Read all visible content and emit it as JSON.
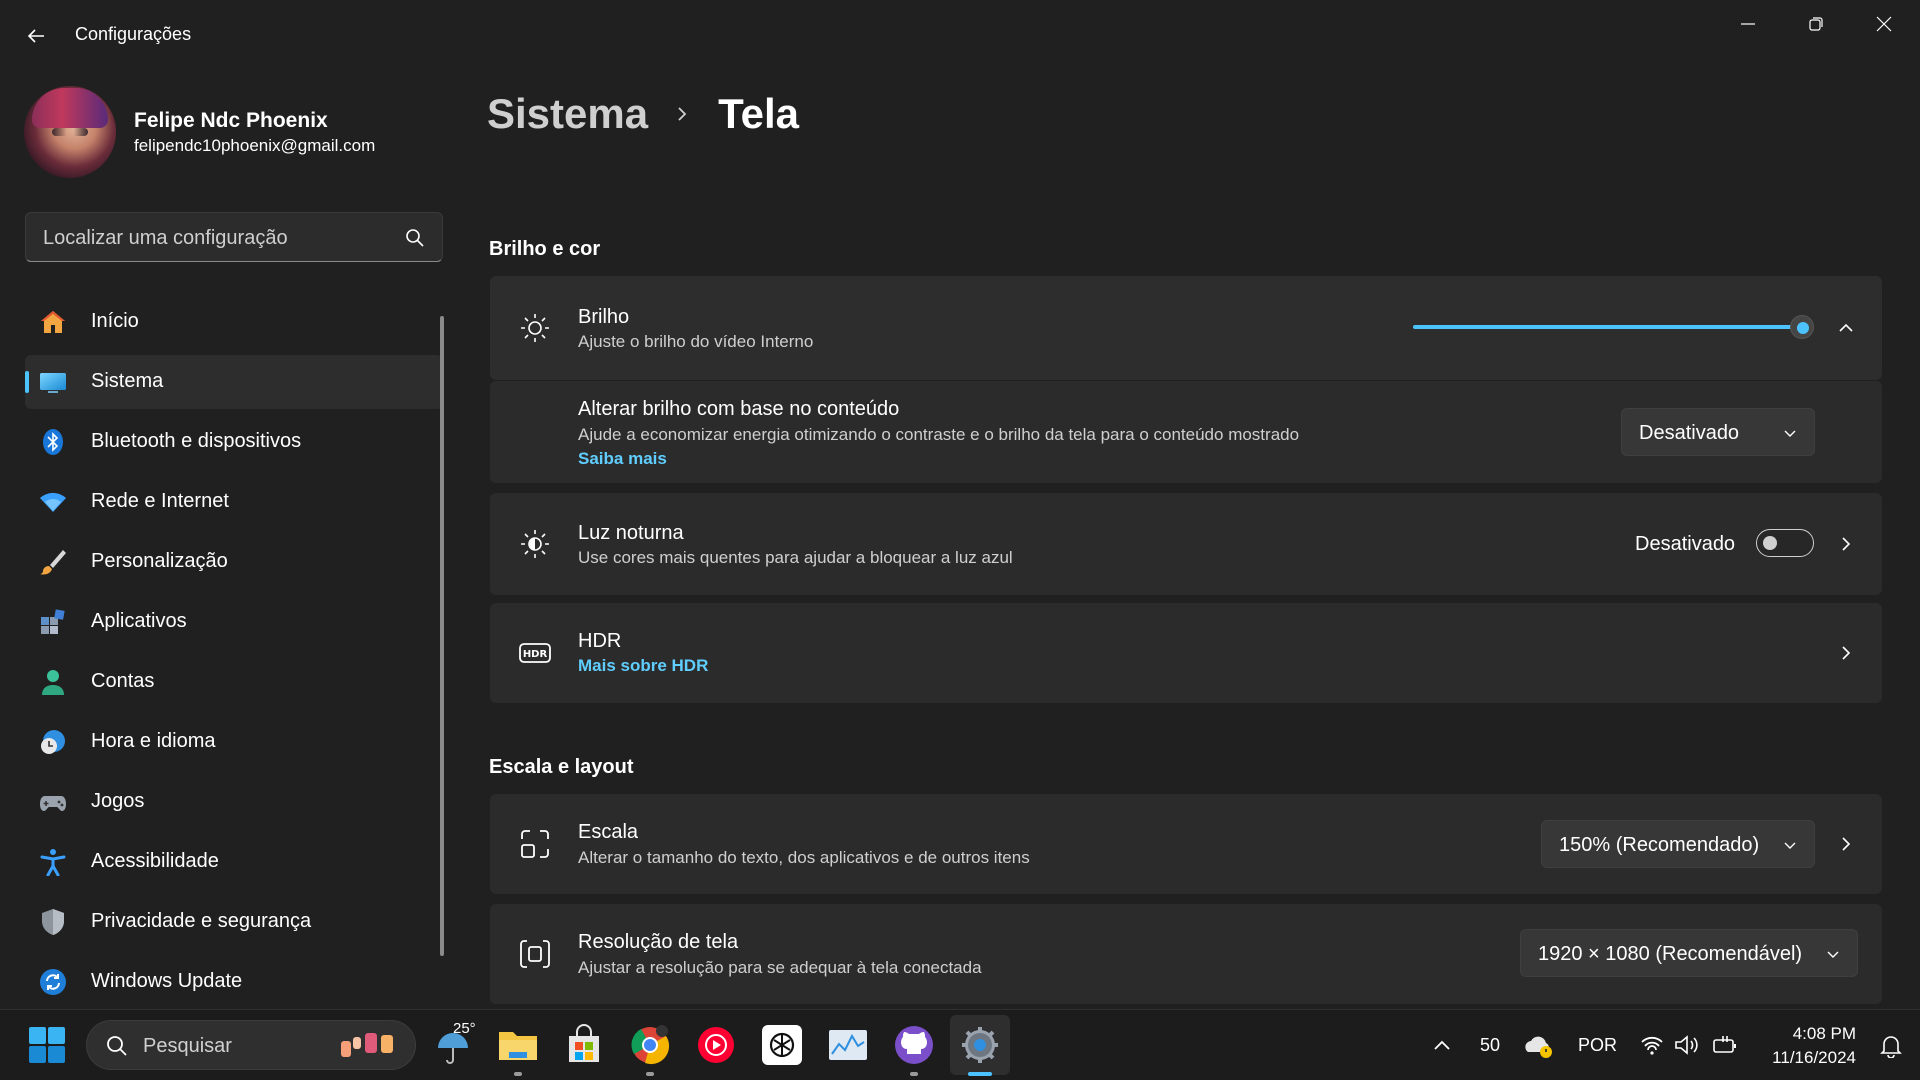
{
  "window": {
    "title": "Configurações"
  },
  "profile": {
    "name": "Felipe Ndc Phoenix",
    "email": "felipendc10phoenix@gmail.com"
  },
  "search": {
    "placeholder": "Localizar uma configuração"
  },
  "sidebar": {
    "items": [
      {
        "label": "Início",
        "icon": "home-icon"
      },
      {
        "label": "Sistema",
        "icon": "system-icon",
        "active": true
      },
      {
        "label": "Bluetooth e dispositivos",
        "icon": "bluetooth-icon"
      },
      {
        "label": "Rede e Internet",
        "icon": "wifi-icon"
      },
      {
        "label": "Personalização",
        "icon": "brush-icon"
      },
      {
        "label": "Aplicativos",
        "icon": "apps-icon"
      },
      {
        "label": "Contas",
        "icon": "account-icon"
      },
      {
        "label": "Hora e idioma",
        "icon": "clock-globe-icon"
      },
      {
        "label": "Jogos",
        "icon": "gamepad-icon"
      },
      {
        "label": "Acessibilidade",
        "icon": "accessibility-icon"
      },
      {
        "label": "Privacidade e segurança",
        "icon": "shield-icon"
      },
      {
        "label": "Windows Update",
        "icon": "update-icon"
      }
    ]
  },
  "breadcrumb": {
    "parent": "Sistema",
    "current": "Tela"
  },
  "sections": {
    "brightness_color": "Brilho e cor",
    "scale_layout": "Escala e layout"
  },
  "brightness": {
    "title": "Brilho",
    "desc": "Ajuste o brilho do vídeo Interno",
    "value_percent": 100
  },
  "content_brightness": {
    "title": "Alterar brilho com base no conteúdo",
    "desc": "Ajude a economizar energia otimizando o contraste e o brilho da tela para o conteúdo mostrado",
    "link": "Saiba mais",
    "value": "Desativado"
  },
  "night_light": {
    "title": "Luz noturna",
    "desc": "Use cores mais quentes para ajudar a bloquear a luz azul",
    "status": "Desativado",
    "on": false
  },
  "hdr": {
    "title": "HDR",
    "link": "Mais sobre HDR"
  },
  "scale": {
    "title": "Escala",
    "desc": "Alterar o tamanho do texto, dos aplicativos e de outros itens",
    "value": "150% (Recomendado)"
  },
  "resolution": {
    "title": "Resolução de tela",
    "desc": "Ajustar a resolução para se adequar à tela conectada",
    "value": "1920 × 1080 (Recomendável)"
  },
  "taskbar": {
    "search_placeholder": "Pesquisar",
    "weather_temp": "25°",
    "battery_percent": "50",
    "language": "POR",
    "time": "4:08 PM",
    "date": "11/16/2024"
  },
  "colors": {
    "accent": "#4cc2ff",
    "link": "#60cdff",
    "background": "#202020",
    "card": "#2b2b2b"
  }
}
